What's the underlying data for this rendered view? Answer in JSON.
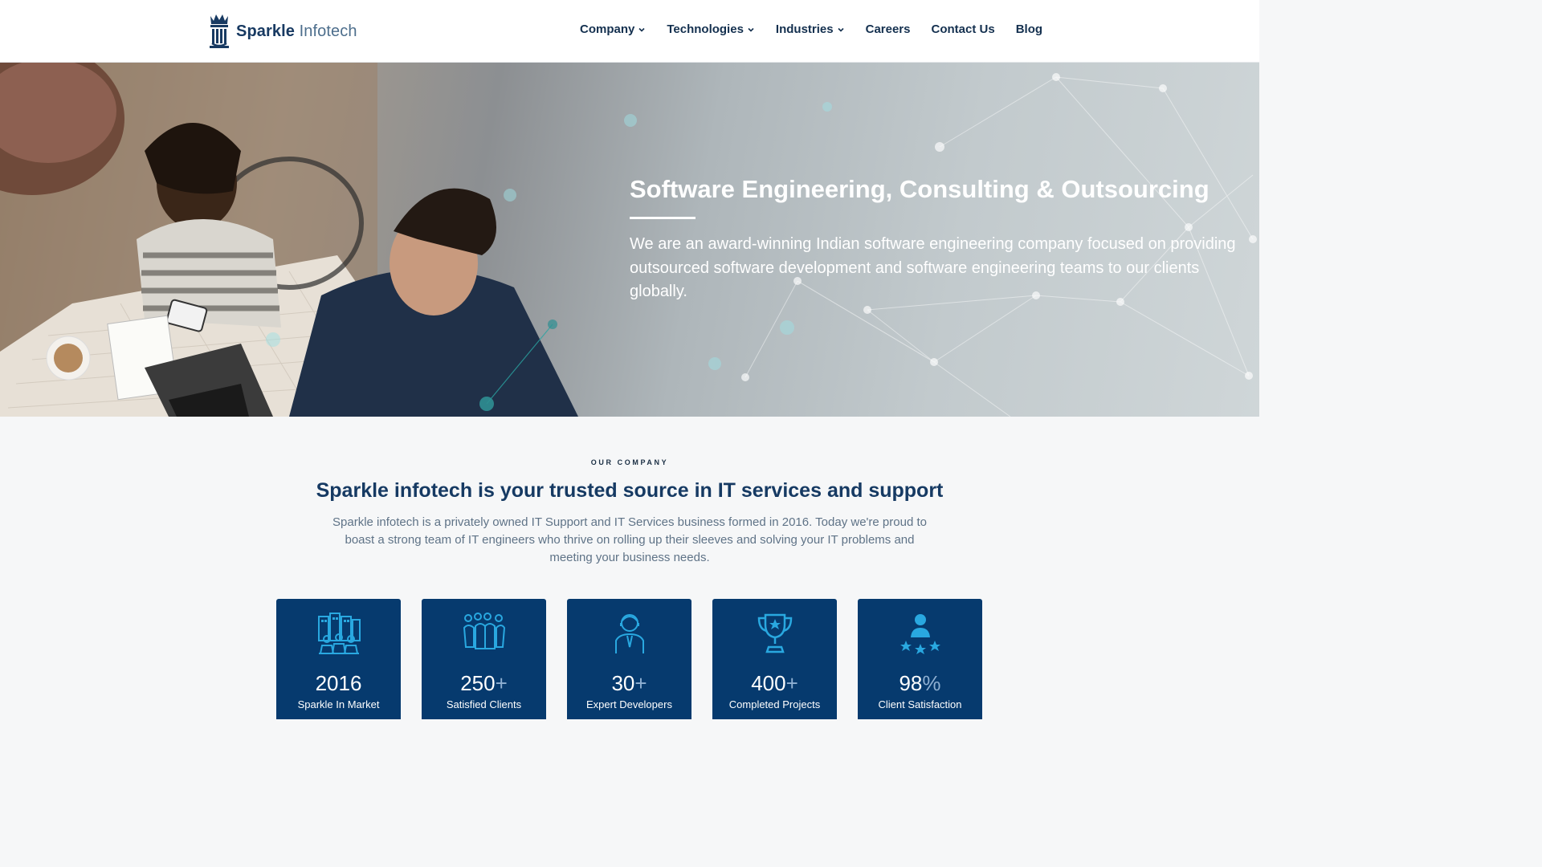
{
  "brand": {
    "name_bold": "Sparkle",
    "name_light": "Infotech"
  },
  "nav": [
    {
      "label": "Company",
      "dropdown": true
    },
    {
      "label": "Technologies",
      "dropdown": true
    },
    {
      "label": "Industries",
      "dropdown": true
    },
    {
      "label": "Careers",
      "dropdown": false
    },
    {
      "label": "Contact Us",
      "dropdown": false
    },
    {
      "label": "Blog",
      "dropdown": false
    }
  ],
  "hero": {
    "title": "Software Engineering, Consulting & Outsourcing",
    "text": "We are an award-winning Indian software engineering company focused on providing outsourced software development and software engineering teams to our clients globally."
  },
  "company": {
    "kicker": "OUR COMPANY",
    "headline": "Sparkle infotech is your trusted source in IT services and support",
    "lead": "Sparkle infotech is a privately owned IT Support and IT Services business formed in 2016. Today we're proud to boast a strong team of IT engineers who thrive on rolling up their sleeves and solving your IT problems and meeting your business needs."
  },
  "stats": [
    {
      "icon": "buildings-team-icon",
      "number": "2016",
      "suffix": "",
      "label": "Sparkle In Market"
    },
    {
      "icon": "group-people-icon",
      "number": "250",
      "suffix": "+",
      "label": "Satisfied Clients"
    },
    {
      "icon": "developer-person-icon",
      "number": "30",
      "suffix": "+",
      "label": "Expert Developers"
    },
    {
      "icon": "trophy-icon",
      "number": "400",
      "suffix": "+",
      "label": "Completed Projects"
    },
    {
      "icon": "user-stars-icon",
      "number": "98",
      "suffix": "%",
      "label": "Client Satisfaction"
    }
  ],
  "colors": {
    "brand_navy": "#063a6e",
    "icon_cyan": "#29a8e0",
    "heading": "#163a63"
  }
}
